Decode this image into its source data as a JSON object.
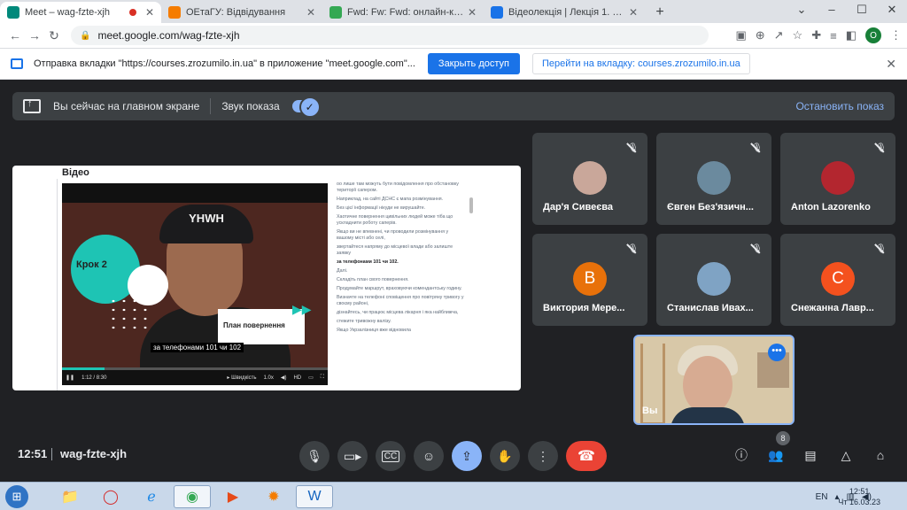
{
  "browser": {
    "tabs": [
      {
        "title": "Meet – wag-fzte-xjh",
        "fav_color": "#00897b",
        "recording": true
      },
      {
        "title": "ОЕтаГУ: Відвідування",
        "fav_color": "#f57c00",
        "recording": false
      },
      {
        "title": "Fwd: Fw: Fwd: онлайн-курс • olg",
        "fav_color": "#34a853",
        "recording": false
      },
      {
        "title": "Відеолекція | Лекція 1. Безп",
        "fav_color": "#1a73e8",
        "recording": false
      }
    ],
    "new_tab": "+",
    "url": "meet.google.com/wag-fzte-xjh",
    "profile_initial": "O"
  },
  "infobar": {
    "message": "Отправка вкладки \"https://courses.zrozumilo.in.ua\" в приложение \"meet.google.com\"...",
    "close_access": "Закрыть доступ",
    "goto_tab": "Перейти на вкладку: courses.zrozumilo.in.ua"
  },
  "presenting": {
    "main_screen": "Вы сейчас на главном экране",
    "sound": "Звук показа",
    "sound_on": true,
    "stop": "Остановить показ"
  },
  "shared": {
    "section_title": "Відео",
    "video": {
      "cap_text": "YHWH",
      "step": "Крок 2",
      "plan": "План повернення",
      "subtitle": "за телефонами 101 чи 102",
      "time": "1:12 / 8:30",
      "speed": "Швидкість",
      "speed_value": "1.0x",
      "hd": "HD",
      "progress": 0.16
    },
    "transcript": [
      {
        "text": "оо лише там можуть бути повідомлення про обстановку території сапером.",
        "bold": false
      },
      {
        "text": "Наприклад, на сайті ДСНС є мапа розмінування.",
        "bold": false
      },
      {
        "text": "Без цієї інформації нікуди не вирушайте.",
        "bold": false
      },
      {
        "text": "Хаотичне повернення цивільних людей може тіба що ускладнити роботу саперів.",
        "bold": false
      },
      {
        "text": "Якщо ви не впевнені, чи проводили розмінування у вашому місті або селі,",
        "bold": false
      },
      {
        "text": "звертайтеся напряму до місцевої влади або залиште заявку",
        "bold": false
      },
      {
        "text": "за телефонами 101 чи 102.",
        "bold": true
      },
      {
        "text": "Далі.",
        "bold": false
      },
      {
        "text": "Складіть план свого повернення.",
        "bold": false
      },
      {
        "text": "Продумайте маршрут, враховуючи комендантську годину.",
        "bold": false
      },
      {
        "text": "Визначте на телефоні сповіщення про повітряну тривогу у своєму районі,",
        "bold": false
      },
      {
        "text": "дізнайтесь, чи працює місцева лікарня і яка найближча,",
        "bold": false
      },
      {
        "text": "стежите тривожну валізу.",
        "bold": false
      },
      {
        "text": "Якщо Укрзалізниця вже відновила",
        "bold": false
      }
    ]
  },
  "participants": [
    {
      "name": "Дар'я Сивеєва",
      "avatar_type": "photo",
      "avatar_color": "#c9a79a",
      "initial": ""
    },
    {
      "name": "Євген Без'язичн...",
      "avatar_type": "photo",
      "avatar_color": "#6b8a9e",
      "initial": ""
    },
    {
      "name": "Anton Lazorenko",
      "avatar_type": "photo",
      "avatar_color": "#b3262f",
      "initial": ""
    },
    {
      "name": "Виктория Мере...",
      "avatar_type": "letter",
      "avatar_color": "#e8710a",
      "initial": "В"
    },
    {
      "name": "Станислав Ивах...",
      "avatar_type": "photo",
      "avatar_color": "#7fa3c4",
      "initial": ""
    },
    {
      "name": "Снежанна Лавр...",
      "avatar_type": "letter",
      "avatar_color": "#f4511e",
      "initial": "С"
    }
  ],
  "self_tile": {
    "label": "Вы"
  },
  "bottom": {
    "time": "12:51",
    "meeting_code": "wag-fzte-xjh",
    "people_count": "8"
  },
  "taskbar": {
    "lang": "EN",
    "clock_time": "12:51",
    "clock_date": "Чт 16.03.23"
  }
}
